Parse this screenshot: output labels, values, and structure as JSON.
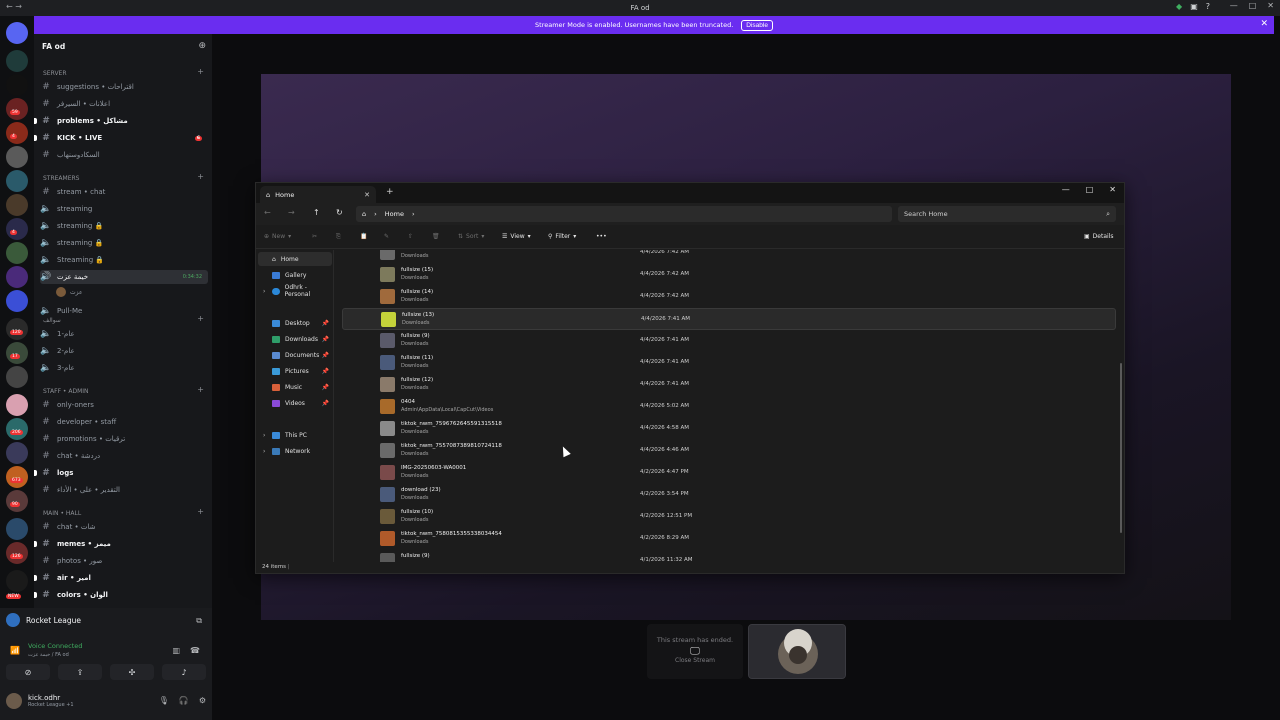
{
  "window": {
    "title": "FA od"
  },
  "banner": {
    "text": "Streamer Mode is enabled. Usernames have been truncated.",
    "disable_label": "Disable",
    "color": "#6a2df0"
  },
  "guild_badges": [
    "59",
    "4",
    "4",
    "120",
    "17",
    "206",
    "673",
    "90",
    "126",
    "NEW"
  ],
  "server": {
    "name": "FA od",
    "categories": [
      {
        "name": "SERVER"
      },
      {
        "name": "STREAMERS"
      },
      {
        "name": "سوالف"
      },
      {
        "name": "STAFF • ADMIN"
      },
      {
        "name": "MAIN • HALL"
      }
    ],
    "channels": [
      {
        "name": "suggestions • اقتراحات",
        "type": "text"
      },
      {
        "name": "اعلانات • السيرفر",
        "type": "text"
      },
      {
        "name": "problems • مشاكل",
        "type": "text"
      },
      {
        "name": "KICK • LIVE",
        "type": "text",
        "badge": "6"
      },
      {
        "name": "السكادوسنهاب",
        "type": "text"
      },
      {
        "name": "stream • chat",
        "type": "text"
      },
      {
        "name": "streaming",
        "type": "voice"
      },
      {
        "name": "streaming 🔒",
        "type": "voice"
      },
      {
        "name": "streaming 🔒",
        "type": "voice"
      },
      {
        "name": "Streaming 🔒",
        "type": "voice"
      },
      {
        "name": "خيمة عزت",
        "type": "voice",
        "right": "0:34:32"
      },
      {
        "name": "Pull-Me",
        "type": "voice"
      },
      {
        "name": "عام-1",
        "type": "voice"
      },
      {
        "name": "عام-2",
        "type": "voice"
      },
      {
        "name": "عام-3",
        "type": "voice"
      },
      {
        "name": "only-oners",
        "type": "text"
      },
      {
        "name": "developer • staff",
        "type": "text"
      },
      {
        "name": "promotions • ترقيات",
        "type": "text"
      },
      {
        "name": "chat • دردشة",
        "type": "text"
      },
      {
        "name": "logs",
        "type": "text"
      },
      {
        "name": "التقدير • على • الأداء",
        "type": "text"
      },
      {
        "name": "chat • شات",
        "type": "text"
      },
      {
        "name": "memes • ميمز",
        "type": "text"
      },
      {
        "name": "photos • صور",
        "type": "text"
      },
      {
        "name": "air • امير",
        "type": "text"
      },
      {
        "name": "colors • الوان",
        "type": "text"
      }
    ],
    "voice_member": "عزت"
  },
  "voice": {
    "activity": "Rocket League",
    "status": "Voice Connected",
    "location": "خيمة عزت / FA od"
  },
  "user": {
    "name": "kick.odhr",
    "status": "Rocket League +1"
  },
  "explorer": {
    "tab_title": "Home",
    "breadcrumb": "Home",
    "search_placeholder": "Search Home",
    "toolbar": {
      "new": "New",
      "sort": "Sort",
      "view": "View",
      "filter": "Filter",
      "details": "Details"
    },
    "nav": [
      {
        "label": "Home"
      },
      {
        "label": "Gallery"
      },
      {
        "label": "Odhrk - Personal"
      },
      {
        "label": "Desktop"
      },
      {
        "label": "Downloads"
      },
      {
        "label": "Documents"
      },
      {
        "label": "Pictures"
      },
      {
        "label": "Music"
      },
      {
        "label": "Videos"
      },
      {
        "label": "This PC"
      },
      {
        "label": "Network"
      }
    ],
    "files": [
      {
        "name": "fullsize (16)",
        "location": "Downloads",
        "date": "4/4/2026 7:42 AM",
        "color": "#6a6a6a"
      },
      {
        "name": "fullsize (15)",
        "location": "Downloads",
        "date": "4/4/2026 7:42 AM",
        "color": "#7d7a5c"
      },
      {
        "name": "fullsize (14)",
        "location": "Downloads",
        "date": "4/4/2026 7:42 AM",
        "color": "#a06a3c"
      },
      {
        "name": "fullsize (13)",
        "location": "Downloads",
        "date": "4/4/2026 7:41 AM",
        "color": "#c4d23a"
      },
      {
        "name": "fullsize (9)",
        "location": "Downloads",
        "date": "4/4/2026 7:41 AM",
        "color": "#5a5a6a"
      },
      {
        "name": "fullsize (11)",
        "location": "Downloads",
        "date": "4/4/2026 7:41 AM",
        "color": "#4a5a7a"
      },
      {
        "name": "fullsize (12)",
        "location": "Downloads",
        "date": "4/4/2026 7:41 AM",
        "color": "#8a7a6a"
      },
      {
        "name": "0404",
        "location": "Admin\\AppData\\Local\\CapCut\\Videos",
        "date": "4/4/2026 5:02 AM",
        "color": "#a86a2a"
      },
      {
        "name": "tiktok_nwm_7596762645591315518",
        "location": "Downloads",
        "date": "4/4/2026 4:58 AM",
        "color": "#8a8a8a"
      },
      {
        "name": "tiktok_nwm_7557087389810724118",
        "location": "Downloads",
        "date": "4/4/2026 4:46 AM",
        "color": "#6a6a6a"
      },
      {
        "name": "IMG-20250603-WA0001",
        "location": "Downloads",
        "date": "4/2/2026 4:47 PM",
        "color": "#7a4a4a"
      },
      {
        "name": "download (23)",
        "location": "Downloads",
        "date": "4/2/2026 3:54 PM",
        "color": "#4a5a7a"
      },
      {
        "name": "fullsize (10)",
        "location": "Downloads",
        "date": "4/2/2026 12:51 PM",
        "color": "#6a5a3a"
      },
      {
        "name": "tiktok_nwm_7580815355338034454",
        "location": "Downloads",
        "date": "4/2/2026 8:29 AM",
        "color": "#b05a2a"
      },
      {
        "name": "fullsize (9)",
        "location": "",
        "date": "4/1/2026 11:32 AM",
        "color": "#5a5a5a"
      }
    ],
    "status": "24 items"
  },
  "stream_tiles": {
    "ended_text": "This stream has ended.",
    "close_label": "Close Stream"
  }
}
